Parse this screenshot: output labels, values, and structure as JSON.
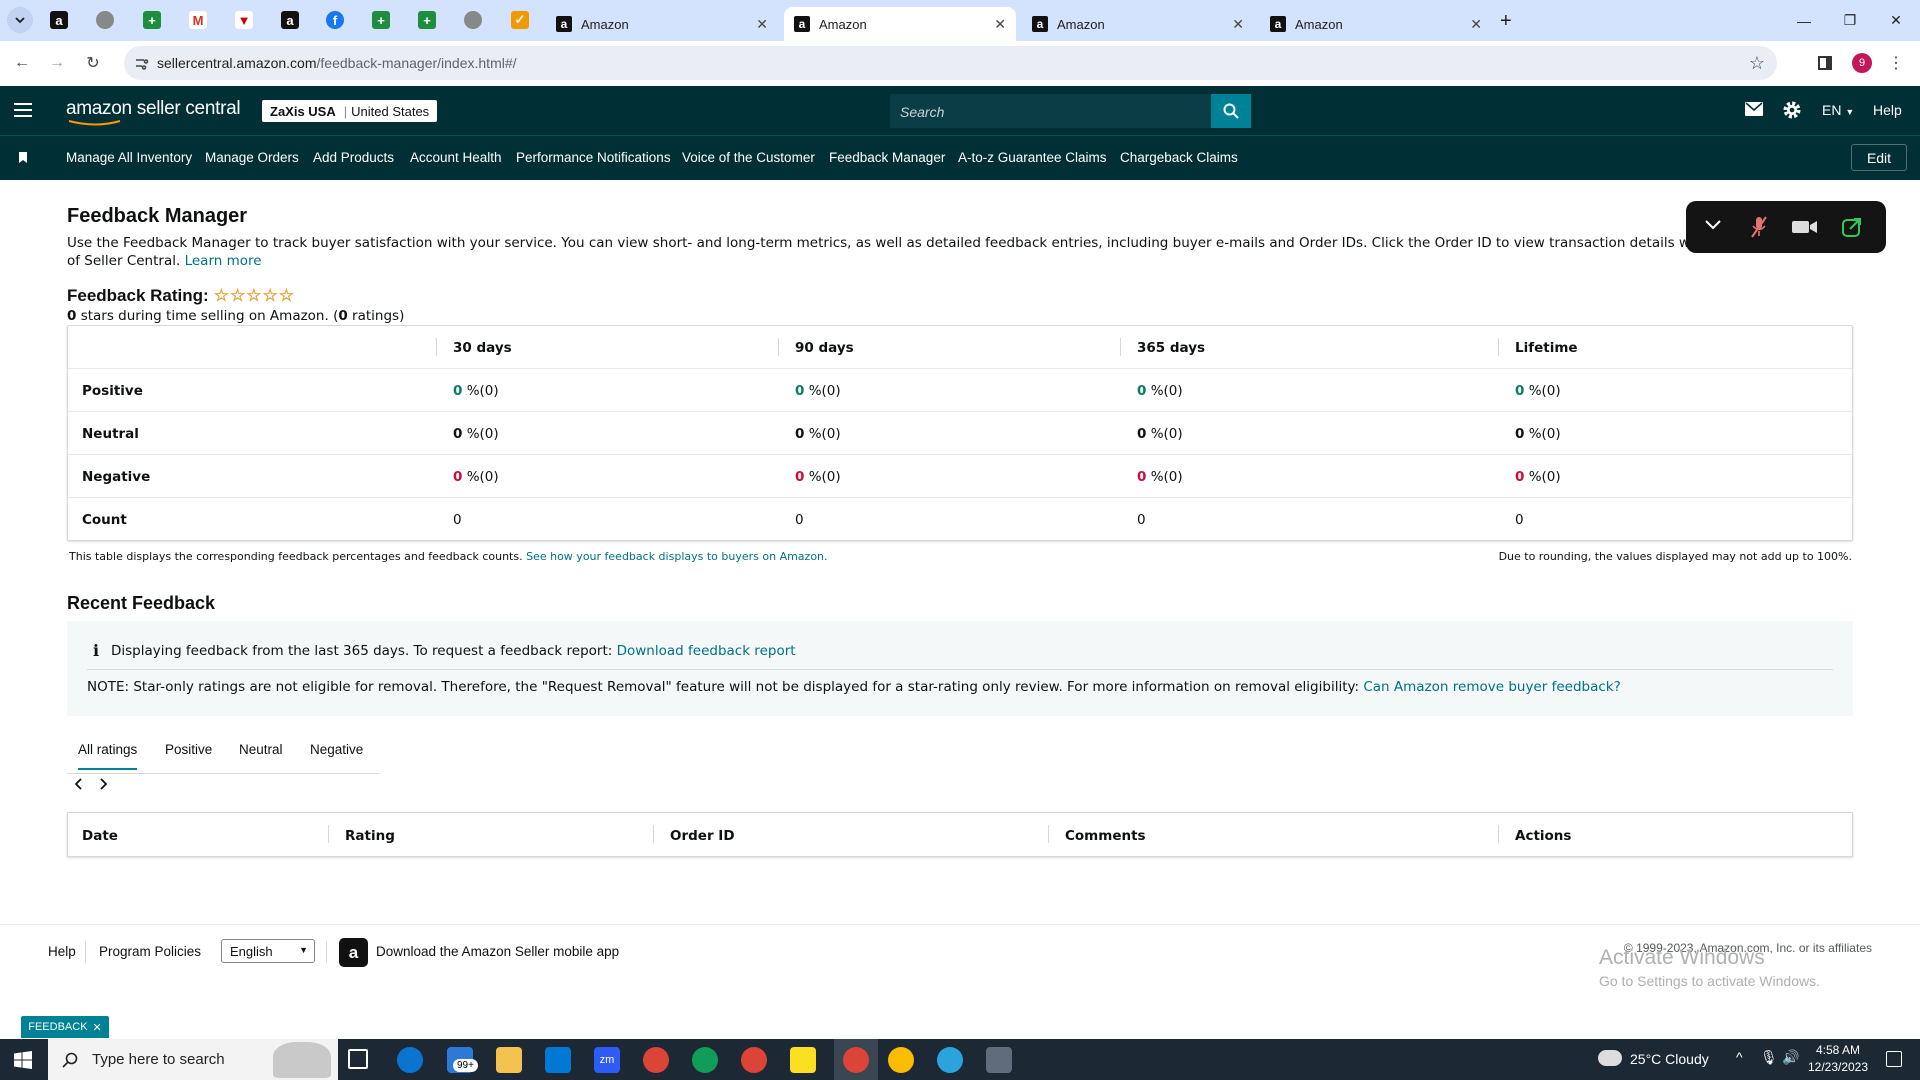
{
  "browser": {
    "tabs": [
      {
        "title": "Amazon",
        "active": false
      },
      {
        "title": "Amazon",
        "active": true
      },
      {
        "title": "Amazon",
        "active": false
      },
      {
        "title": "Amazon",
        "active": false
      }
    ],
    "url_domain": "sellercentral.amazon.com",
    "url_path": "/feedback-manager/index.html#/",
    "profile_initial": "9"
  },
  "header": {
    "logo_text": "amazon seller central",
    "store_name": "ZaXis USA",
    "store_sep": "|",
    "store_region": "United States",
    "search_placeholder": "Search",
    "language": "EN",
    "help": "Help"
  },
  "nav": {
    "items": [
      "Manage All Inventory",
      "Manage Orders",
      "Add Products",
      "Account Health",
      "Performance Notifications",
      "Voice of the Customer",
      "Feedback Manager",
      "A-to-z Guarantee Claims",
      "Chargeback Claims"
    ],
    "edit": "Edit"
  },
  "page": {
    "title": "Feedback Manager",
    "intro": "Use the Feedback Manager to track buyer satisfaction with your service. You can view short- and long-term metrics, as well as detailed feedback entries, including buyer e-mails and Order IDs. Click the Order ID to view transaction details within the Manage Orders section",
    "intro_line2": "of Seller Central.",
    "learn_more": "Learn more"
  },
  "rating": {
    "label": "Feedback Rating:",
    "stars": 0,
    "max_stars": 5,
    "summary_stars": "0",
    "summary_mid": "stars during time selling on Amazon. (",
    "summary_count": "0",
    "summary_end": "ratings)"
  },
  "feedback_table": {
    "columns": [
      "30 days",
      "90 days",
      "365 days",
      "Lifetime"
    ],
    "rows": [
      {
        "label": "Positive",
        "values": [
          "0",
          "0",
          "0",
          "0"
        ],
        "suffix": "%(0)",
        "color": "#067d62"
      },
      {
        "label": "Neutral",
        "values": [
          "0",
          "0",
          "0",
          "0"
        ],
        "suffix": "%(0)",
        "color": "#0f1111"
      },
      {
        "label": "Negative",
        "values": [
          "0",
          "0",
          "0",
          "0"
        ],
        "suffix": "%(0)",
        "color": "#cc0c39"
      }
    ],
    "count_label": "Count",
    "counts": [
      "0",
      "0",
      "0",
      "0"
    ],
    "note": "This table displays the corresponding feedback percentages and feedback counts.",
    "note_link": "See how your feedback displays to buyers on Amazon.",
    "rounding_note": "Due to rounding, the values displayed may not add up to 100%."
  },
  "recent": {
    "title": "Recent Feedback",
    "info": "Displaying feedback from the last 365 days. To request a feedback report:",
    "info_link": "Download feedback report",
    "note": "NOTE: Star-only ratings are not eligible for removal. Therefore, the \"Request Removal\" feature will not be displayed for a star-rating only review. For more information on removal eligibility:",
    "note_link": "Can Amazon remove buyer feedback?",
    "tabs": [
      "All ratings",
      "Positive",
      "Neutral",
      "Negative"
    ],
    "columns": [
      "Date",
      "Rating",
      "Order ID",
      "Comments",
      "Actions"
    ]
  },
  "footer": {
    "help": "Help",
    "policies": "Program Policies",
    "language_selected": "English",
    "app_text": "Download the Amazon Seller mobile app",
    "copyright": "© 1999-2023, Amazon.com, Inc. or its affiliates",
    "watermark_1": "Activate Windows",
    "watermark_2": "Go to Settings to activate Windows."
  },
  "feedback_tab": "FEEDBACK",
  "taskbar": {
    "search": "Type here to search",
    "weather": "25°C  Cloudy",
    "time": "4:58 AM",
    "date": "12/23/2023",
    "mail_badge": "99+"
  },
  "colors": {
    "header_bg": "#002f36",
    "link": "#007185",
    "accent": "#008296",
    "positive": "#067d62",
    "negative": "#cc0c39",
    "star": "#e7a43a"
  }
}
